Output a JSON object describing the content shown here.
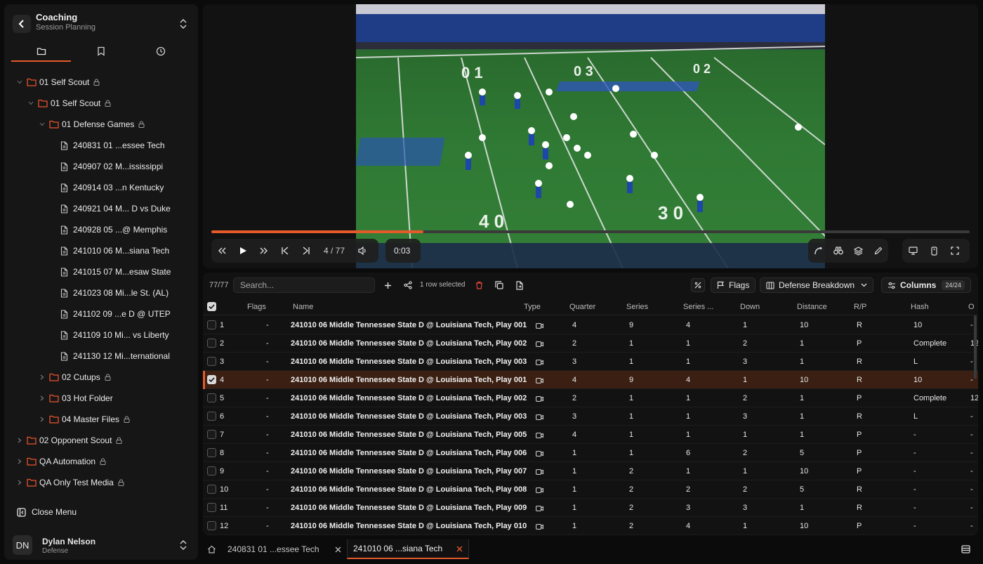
{
  "app": {
    "title": "Coaching",
    "subtitle": "Session Planning"
  },
  "sidebar": {
    "tabs": [
      "folder-icon",
      "bookmark-icon",
      "clock-icon"
    ],
    "tree": [
      {
        "label": "01 Self Scout",
        "level": 0,
        "kind": "folder",
        "open": true,
        "locked": true
      },
      {
        "label": "01 Self Scout",
        "level": 1,
        "kind": "folder",
        "open": true,
        "locked": true
      },
      {
        "label": "01 Defense Games",
        "level": 2,
        "kind": "folder",
        "open": true,
        "locked": true
      },
      {
        "label": "240831 01 ...essee Tech",
        "level": 3,
        "kind": "file"
      },
      {
        "label": "240907 02 M...ississippi",
        "level": 3,
        "kind": "file"
      },
      {
        "label": "240914 03 ...n Kentucky",
        "level": 3,
        "kind": "file"
      },
      {
        "label": "240921 04 M... D vs Duke",
        "level": 3,
        "kind": "file"
      },
      {
        "label": "240928 05 ...@ Memphis",
        "level": 3,
        "kind": "file"
      },
      {
        "label": "241010 06 M...siana Tech",
        "level": 3,
        "kind": "file"
      },
      {
        "label": "241015 07 M...esaw State",
        "level": 3,
        "kind": "file"
      },
      {
        "label": "241023 08 Mi...le St. (AL)",
        "level": 3,
        "kind": "file"
      },
      {
        "label": "241102 09 ...e D @ UTEP",
        "level": 3,
        "kind": "file"
      },
      {
        "label": "241109 10 Mi... vs Liberty",
        "level": 3,
        "kind": "file"
      },
      {
        "label": "241130 12 Mi...ternational",
        "level": 3,
        "kind": "file"
      },
      {
        "label": "02 Cutups",
        "level": 2,
        "kind": "folder",
        "open": false,
        "locked": true
      },
      {
        "label": "03 Hot Folder",
        "level": 2,
        "kind": "folder",
        "open": false,
        "locked": false
      },
      {
        "label": "04 Master Files",
        "level": 2,
        "kind": "folder",
        "open": false,
        "locked": true
      },
      {
        "label": "02 Opponent Scout",
        "level": 0,
        "kind": "folder",
        "open": false,
        "locked": true
      },
      {
        "label": "QA Automation",
        "level": 0,
        "kind": "folder",
        "open": false,
        "locked": true
      },
      {
        "label": "QA Only Test Media",
        "level": 0,
        "kind": "folder",
        "open": false,
        "locked": true
      }
    ],
    "close_menu": "Close Menu",
    "user": {
      "initials": "DN",
      "name": "Dylan Nelson",
      "role": "Defense"
    }
  },
  "player": {
    "counter": "4 / 77",
    "time": "0:03",
    "progress": 0.28,
    "accent": "#e55a2b"
  },
  "table": {
    "count": "77/77",
    "search_placeholder": "Search...",
    "selection_info": "1 row selected",
    "flags_label": "Flags",
    "breakdown_label": "Defense Breakdown",
    "columns_label": "Columns",
    "columns_badge": "24/24",
    "headers": [
      "Flags",
      "Name",
      "Type",
      "Quarter",
      "Series",
      "Series ...",
      "Down",
      "Distance",
      "R/P",
      "Hash",
      "O"
    ],
    "rows": [
      {
        "n": "1",
        "flags": "-",
        "name": "241010 06 Middle Tennessee State D @ Louisiana Tech, Play 001",
        "quarter": "4",
        "series": "9",
        "series2": "4",
        "down": "1",
        "distance": "10",
        "rp": "R",
        "hash": "10",
        "o": "-",
        "selected": false
      },
      {
        "n": "2",
        "flags": "-",
        "name": "241010 06 Middle Tennessee State D @ Louisiana Tech, Play 002",
        "quarter": "2",
        "series": "1",
        "series2": "1",
        "down": "2",
        "distance": "1",
        "rp": "P",
        "hash": "Complete",
        "o": "12",
        "selected": false
      },
      {
        "n": "3",
        "flags": "-",
        "name": "241010 06 Middle Tennessee State D @ Louisiana Tech, Play 003",
        "quarter": "3",
        "series": "1",
        "series2": "1",
        "down": "3",
        "distance": "1",
        "rp": "R",
        "hash": "L",
        "o": "-",
        "selected": false
      },
      {
        "n": "4",
        "flags": "-",
        "name": "241010 06 Middle Tennessee State D @ Louisiana Tech, Play 001",
        "quarter": "4",
        "series": "9",
        "series2": "4",
        "down": "1",
        "distance": "10",
        "rp": "R",
        "hash": "10",
        "o": "-",
        "selected": true
      },
      {
        "n": "5",
        "flags": "-",
        "name": "241010 06 Middle Tennessee State D @ Louisiana Tech, Play 002",
        "quarter": "2",
        "series": "1",
        "series2": "1",
        "down": "2",
        "distance": "1",
        "rp": "P",
        "hash": "Complete",
        "o": "12",
        "selected": false
      },
      {
        "n": "6",
        "flags": "-",
        "name": "241010 06 Middle Tennessee State D @ Louisiana Tech, Play 003",
        "quarter": "3",
        "series": "1",
        "series2": "1",
        "down": "3",
        "distance": "1",
        "rp": "R",
        "hash": "L",
        "o": "-",
        "selected": false
      },
      {
        "n": "7",
        "flags": "-",
        "name": "241010 06 Middle Tennessee State D @ Louisiana Tech, Play 005",
        "quarter": "4",
        "series": "1",
        "series2": "1",
        "down": "1",
        "distance": "1",
        "rp": "P",
        "hash": "-",
        "o": "-",
        "selected": false
      },
      {
        "n": "8",
        "flags": "-",
        "name": "241010 06 Middle Tennessee State D @ Louisiana Tech, Play 006",
        "quarter": "1",
        "series": "1",
        "series2": "6",
        "down": "2",
        "distance": "5",
        "rp": "P",
        "hash": "-",
        "o": "-",
        "selected": false
      },
      {
        "n": "9",
        "flags": "-",
        "name": "241010 06 Middle Tennessee State D @ Louisiana Tech, Play 007",
        "quarter": "1",
        "series": "2",
        "series2": "1",
        "down": "1",
        "distance": "10",
        "rp": "P",
        "hash": "-",
        "o": "-",
        "selected": false
      },
      {
        "n": "10",
        "flags": "-",
        "name": "241010 06 Middle Tennessee State D @ Louisiana Tech, Play 008",
        "quarter": "1",
        "series": "2",
        "series2": "2",
        "down": "2",
        "distance": "5",
        "rp": "R",
        "hash": "-",
        "o": "-",
        "selected": false
      },
      {
        "n": "11",
        "flags": "-",
        "name": "241010 06 Middle Tennessee State D @ Louisiana Tech, Play 009",
        "quarter": "1",
        "series": "2",
        "series2": "3",
        "down": "3",
        "distance": "1",
        "rp": "R",
        "hash": "-",
        "o": "-",
        "selected": false
      },
      {
        "n": "12",
        "flags": "-",
        "name": "241010 06 Middle Tennessee State D @ Louisiana Tech, Play 010",
        "quarter": "1",
        "series": "2",
        "series2": "4",
        "down": "1",
        "distance": "10",
        "rp": "P",
        "hash": "-",
        "o": "-",
        "selected": false
      }
    ]
  },
  "bottom_tabs": [
    {
      "label": "240831 01 ...essee Tech",
      "active": false
    },
    {
      "label": "241010 06 ...siana Tech",
      "active": true
    }
  ]
}
